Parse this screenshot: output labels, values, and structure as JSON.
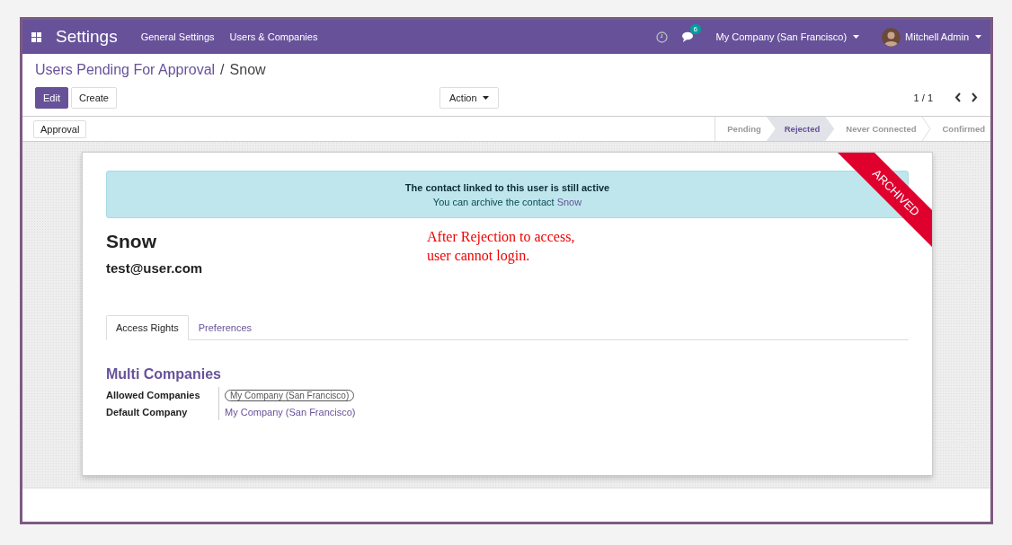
{
  "navbar": {
    "app_title": "Settings",
    "menu": [
      "General Settings",
      "Users & Companies"
    ],
    "messages_count": "6",
    "company": "My Company (San Francisco)",
    "user": "Mitchell Admin"
  },
  "breadcrumb": {
    "parent": "Users Pending For Approval",
    "separator": "/",
    "current": "Snow"
  },
  "buttons": {
    "edit": "Edit",
    "create": "Create",
    "action": "Action"
  },
  "pager": "1 / 1",
  "header_buttons": [
    "Approval"
  ],
  "stages": [
    {
      "label": "Pending",
      "selected": false
    },
    {
      "label": "Rejected",
      "selected": true
    },
    {
      "label": "Never Connected",
      "selected": false
    },
    {
      "label": "Confirmed",
      "selected": false
    }
  ],
  "sheet": {
    "ribbon": "ARCHIVED",
    "alert": {
      "title": "The contact linked to this user is still active",
      "text": "You can archive the contact",
      "link": "Snow"
    },
    "name": "Snow",
    "login": "test@user.com",
    "annotation": "After Rejection to access,\nuser cannot login.",
    "tabs": [
      {
        "label": "Access Rights",
        "selected": true
      },
      {
        "label": "Preferences",
        "selected": false
      }
    ],
    "section_title": "Multi Companies",
    "fields": [
      {
        "label": "Allowed Companies",
        "value": "My Company (San Francisco)",
        "kind": "tag"
      },
      {
        "label": "Default Company",
        "value": "My Company (San Francisco)",
        "kind": "link"
      }
    ]
  }
}
